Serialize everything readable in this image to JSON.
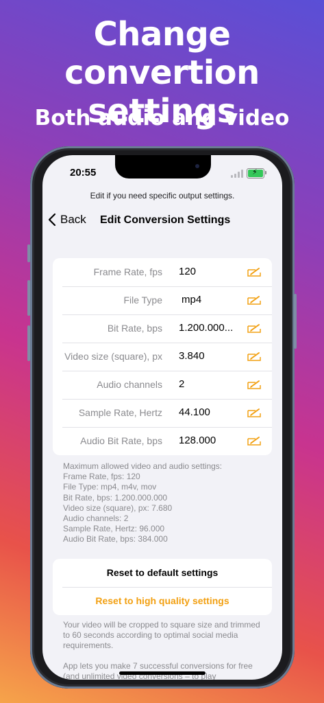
{
  "hero": {
    "title_line1": "Change convertion",
    "title_line2": "settings",
    "subtitle": "Both audio and video"
  },
  "status_bar": {
    "time": "20:55",
    "battery_color": "#34c759"
  },
  "hint": "Edit if you need specific output settings.",
  "nav": {
    "back_label": "Back",
    "title": "Edit Conversion Settings"
  },
  "settings": [
    {
      "label": "Frame Rate, fps",
      "value": "120"
    },
    {
      "label": "File Type",
      "value": "mp4"
    },
    {
      "label": "Bit Rate, bps",
      "value": "1.200.000..."
    },
    {
      "label": "Video size (square), px",
      "value": "3.840"
    },
    {
      "label": "Audio channels",
      "value": "2"
    },
    {
      "label": "Sample Rate, Hertz",
      "value": "44.100"
    },
    {
      "label": "Audio Bit Rate, bps",
      "value": "128.000"
    }
  ],
  "limits": [
    "Maximum allowed video and audio settings:",
    "Frame Rate, fps: 120",
    "File Type: mp4, m4v, mov",
    "Bit Rate, bps: 1.200.000.000",
    "Video size (square), px: 7.680",
    "Audio channels: 2",
    "Sample Rate, Hertz: 96.000",
    "Audio Bit Rate, bps: 384.000"
  ],
  "actions": {
    "reset_default": "Reset to default settings",
    "reset_high": "Reset to high quality settings"
  },
  "notes": {
    "crop_note": "Your video will be cropped to square size and trimmed to 60 seconds according to optimal social media requirements.",
    "free_note": "App lets you make 7 successful conversions for free (and unlimited video conversions – to play"
  },
  "colors": {
    "accent": "#f2a012",
    "edit_icon": "#f2a012"
  }
}
